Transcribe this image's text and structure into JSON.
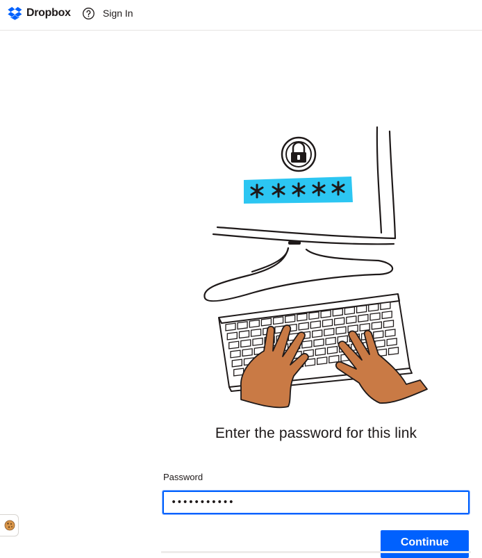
{
  "header": {
    "brand": "Dropbox",
    "help_icon": "question-circle-icon",
    "signin_label": "Sign In"
  },
  "illustration": {
    "icon": "lock-keyboard-illustration",
    "password_mask": "*****",
    "accent_color": "#2cc6f2",
    "hand_color": "#c97a45"
  },
  "main": {
    "heading": "Enter the password for this link",
    "password_label": "Password",
    "password_value": "•••••••••••",
    "continue_label": "Continue"
  },
  "cookie": {
    "icon": "cookie-icon"
  },
  "colors": {
    "brand_blue": "#0061fe",
    "text": "#1e1919"
  }
}
